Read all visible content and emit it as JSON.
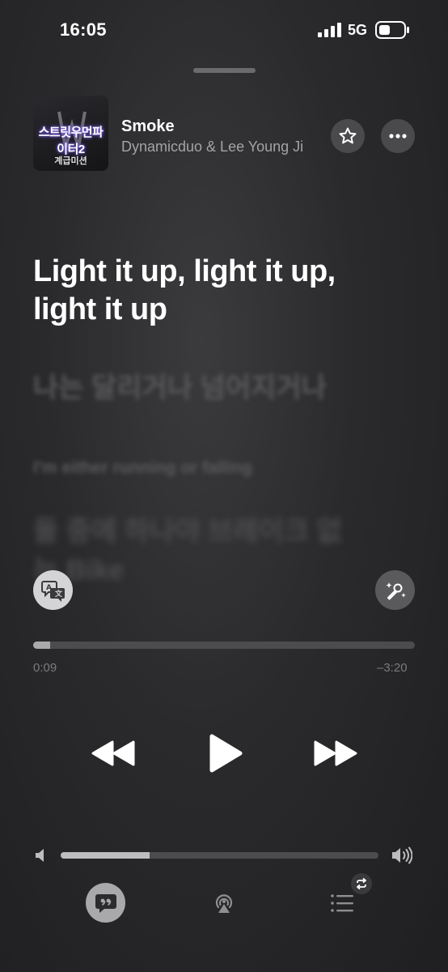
{
  "status_bar": {
    "time": "16:05",
    "network": "5G"
  },
  "now_playing": {
    "artwork": {
      "title_text": "스트릿우먼파이터2",
      "subtitle_text": "계급미션"
    },
    "title": "Smoke",
    "artist": "Dynamicduo & Lee Young Ji"
  },
  "lyrics": {
    "current": "Light it up, light it up, light it up",
    "next": "나는 달리거나 넘어지거나",
    "next_translation": "I'm either running or falling",
    "after": "둘 중에 하나야 브레이크 없는 Bike"
  },
  "playback": {
    "elapsed": "0:09",
    "remaining": "–3:20",
    "progress_fraction": 0.045,
    "volume_fraction": 0.28
  },
  "icons": {
    "favorite": "star-icon",
    "more": "ellipsis-icon",
    "translate": "translate-icon",
    "sing": "microphone-sparkle-icon",
    "rewind": "rewind-icon",
    "play": "play-icon",
    "forward": "fast-forward-icon",
    "lyrics": "quote-bubble-icon",
    "airplay": "airplay-icon",
    "queue": "list-icon",
    "repeat": "repeat-icon"
  },
  "colors": {
    "background": "#2a2a2c",
    "secondary_text": "#a3a3a6",
    "accent_glow": "#8a6cff"
  }
}
